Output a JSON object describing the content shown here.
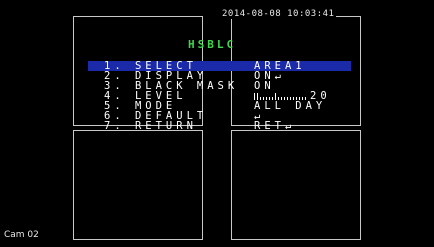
{
  "timestamp": "2014-08-08 10:03:41",
  "menu_title": "HSBLC",
  "menu": {
    "items": [
      {
        "label": "1. SELECT",
        "value": "AREA1"
      },
      {
        "label": "2. DISPLAY",
        "value": "ON↵"
      },
      {
        "label": "3. BLACK MASK",
        "value": "ON"
      },
      {
        "label": "4. LEVEL",
        "value": "20"
      },
      {
        "label": "5. MODE",
        "value": "ALL DAY"
      },
      {
        "label": "6. DEFAULT",
        "value": "↵"
      },
      {
        "label": "7. RETURN",
        "value": "RET↵"
      }
    ],
    "selected_index": 0,
    "level_fraction": 0.4
  },
  "camera_label": "Cam 02",
  "colors": {
    "title": "#3fd64b",
    "highlight": "#1a2aa8",
    "text": "#ffffff",
    "background": "#000000"
  }
}
